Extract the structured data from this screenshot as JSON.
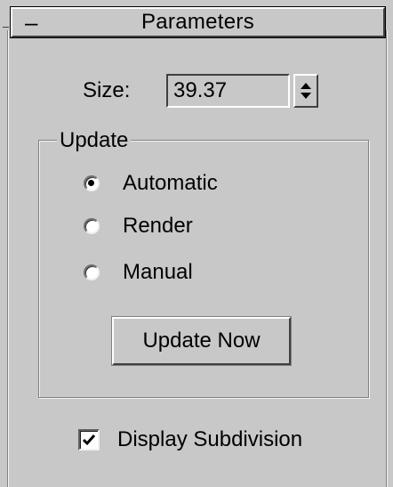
{
  "rollout": {
    "collapse_symbol": "–",
    "title": "Parameters"
  },
  "size": {
    "label": "Size:",
    "value": "39.37"
  },
  "update_group": {
    "title": "Update",
    "options": [
      {
        "label": "Automatic",
        "selected": true
      },
      {
        "label": "Render",
        "selected": false
      },
      {
        "label": "Manual",
        "selected": false
      }
    ],
    "update_now_label": "Update Now"
  },
  "display_subdivision": {
    "label": "Display Subdivision",
    "checked": true
  },
  "icons": {
    "spinner": "spinner-arrows-icon",
    "check": "checkmark-icon"
  }
}
